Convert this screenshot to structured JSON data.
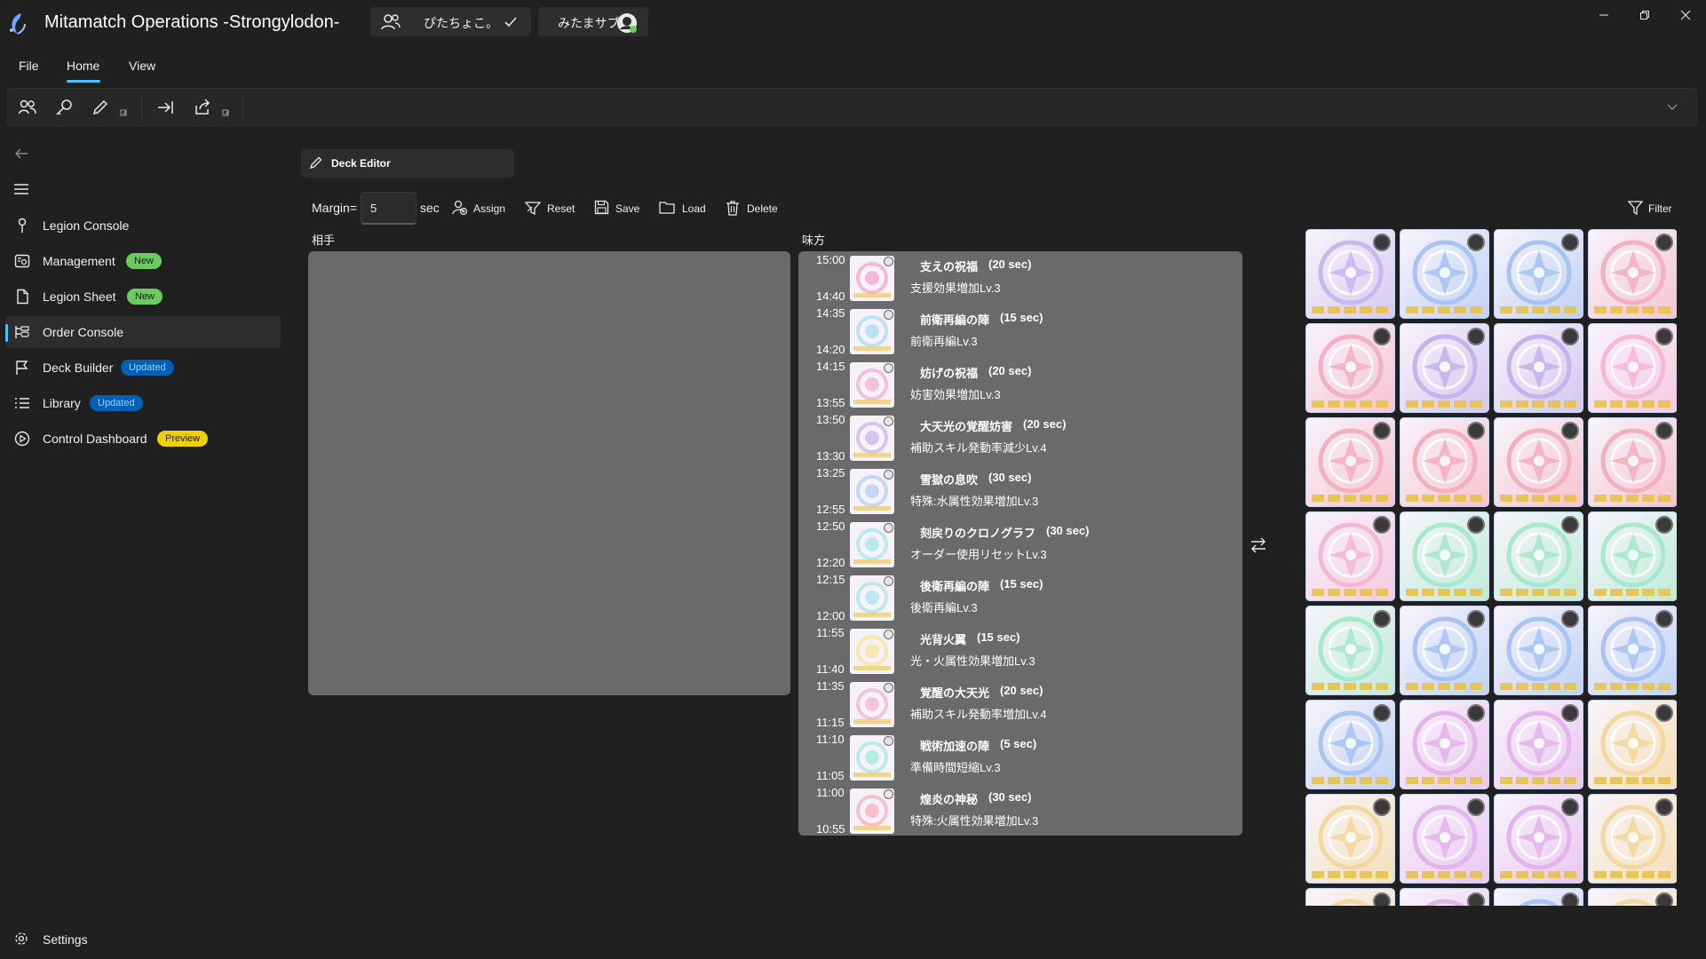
{
  "window": {
    "title": "Mitamatch Operations -Strongylodon-",
    "account_label": "ぴたちょこ。",
    "user_label": "みたまサブ"
  },
  "menu": {
    "file": "File",
    "home": "Home",
    "view": "View"
  },
  "sidebar": {
    "items": [
      {
        "label": "Legion Console",
        "badge": ""
      },
      {
        "label": "Management",
        "badge": "New"
      },
      {
        "label": "Legion Sheet",
        "badge": "New"
      },
      {
        "label": "Order Console",
        "badge": ""
      },
      {
        "label": "Deck Builder",
        "badge": "Updated"
      },
      {
        "label": "Library",
        "badge": "Updated"
      },
      {
        "label": "Control Dashboard",
        "badge": "Preview"
      }
    ],
    "settings": "Settings"
  },
  "editor": {
    "tab_label": "Deck Editor",
    "margin_label": "Margin=",
    "margin_value": "5",
    "sec_label": "sec",
    "assign": "Assign",
    "reset": "Reset",
    "save": "Save",
    "load": "Load",
    "delete": "Delete",
    "filter": "Filter",
    "opponent_header": "相手",
    "ally_header": "味方"
  },
  "orders": [
    {
      "start": "15:00",
      "end": "14:40",
      "name": "支えの祝福",
      "duration": "(20 sec)",
      "effect": "支援効果増加Lv.3",
      "color": "#f4b8d8"
    },
    {
      "start": "14:35",
      "end": "14:20",
      "name": "前衛再編の陣",
      "duration": "(15 sec)",
      "effect": "前衛再編Lv.3",
      "color": "#b8e4f4"
    },
    {
      "start": "14:15",
      "end": "13:55",
      "name": "妨げの祝福",
      "duration": "(20 sec)",
      "effect": "妨害効果増加Lv.3",
      "color": "#f4c0dc"
    },
    {
      "start": "13:50",
      "end": "13:30",
      "name": "大天光の覚醒妨害",
      "duration": "(20 sec)",
      "effect": "補助スキル発動率減少Lv.4",
      "color": "#d4c4f0"
    },
    {
      "start": "13:25",
      "end": "12:55",
      "name": "雪獄の息吹",
      "duration": "(30 sec)",
      "effect": "特殊:水属性効果増加Lv.3",
      "color": "#c4d8f8"
    },
    {
      "start": "12:50",
      "end": "12:20",
      "name": "刻戻りのクロノグラフ",
      "duration": "(30 sec)",
      "effect": "オーダー使用リセットLv.3",
      "color": "#b8ecf0"
    },
    {
      "start": "12:15",
      "end": "12:00",
      "name": "後衛再編の陣",
      "duration": "(15 sec)",
      "effect": "後衛再編Lv.3",
      "color": "#bce8f0"
    },
    {
      "start": "11:55",
      "end": "11:40",
      "name": "光背火翼",
      "duration": "(15 sec)",
      "effect": "光・火属性効果増加Lv.3",
      "color": "#f8e8b0"
    },
    {
      "start": "11:35",
      "end": "11:15",
      "name": "覚醒の大天光",
      "duration": "(20 sec)",
      "effect": "補助スキル発動率増加Lv.4",
      "color": "#f4c4dc"
    },
    {
      "start": "11:10",
      "end": "11:05",
      "name": "戦術加速の陣",
      "duration": "(5 sec)",
      "effect": "準備時間短縮Lv.3",
      "color": "#b8ecec"
    },
    {
      "start": "11:00",
      "end": "10:55",
      "name": "煌炎の神秘",
      "duration": "(30 sec)",
      "effect": "特殊:火属性効果増加Lv.3",
      "color": "#f8c0c8"
    }
  ],
  "card_colors": [
    [
      "#c9b8f0",
      "#a9c4f4",
      "#a9c4f4",
      "#f4b0c4"
    ],
    [
      "#f4b0c4",
      "#c4b4ec",
      "#c4b4ec",
      "#f4b8d8"
    ],
    [
      "#f4b0c0",
      "#f4b0c0",
      "#f4b0c0",
      "#f4b0c0"
    ],
    [
      "#f4b8d4",
      "#a8e8cc",
      "#a8e8cc",
      "#a8e8cc"
    ],
    [
      "#a8e8cc",
      "#a9c4f4",
      "#a9c4f4",
      "#a9c4f4"
    ],
    [
      "#a9c4f4",
      "#e4b4ec",
      "#e4b4ec",
      "#f4d8a0"
    ],
    [
      "#f4d8a0",
      "#e4b4ec",
      "#e4b4ec",
      "#f4d8a0"
    ],
    [
      "#f4d8a0",
      "#e4b4ec",
      "#a9c4f4",
      "#f4d8a0"
    ]
  ],
  "colors": {
    "accent": "#4cc2ff",
    "badge_new": "#6ccb5f",
    "badge_updated": "#005fb8",
    "badge_preview": "#f0d000"
  }
}
